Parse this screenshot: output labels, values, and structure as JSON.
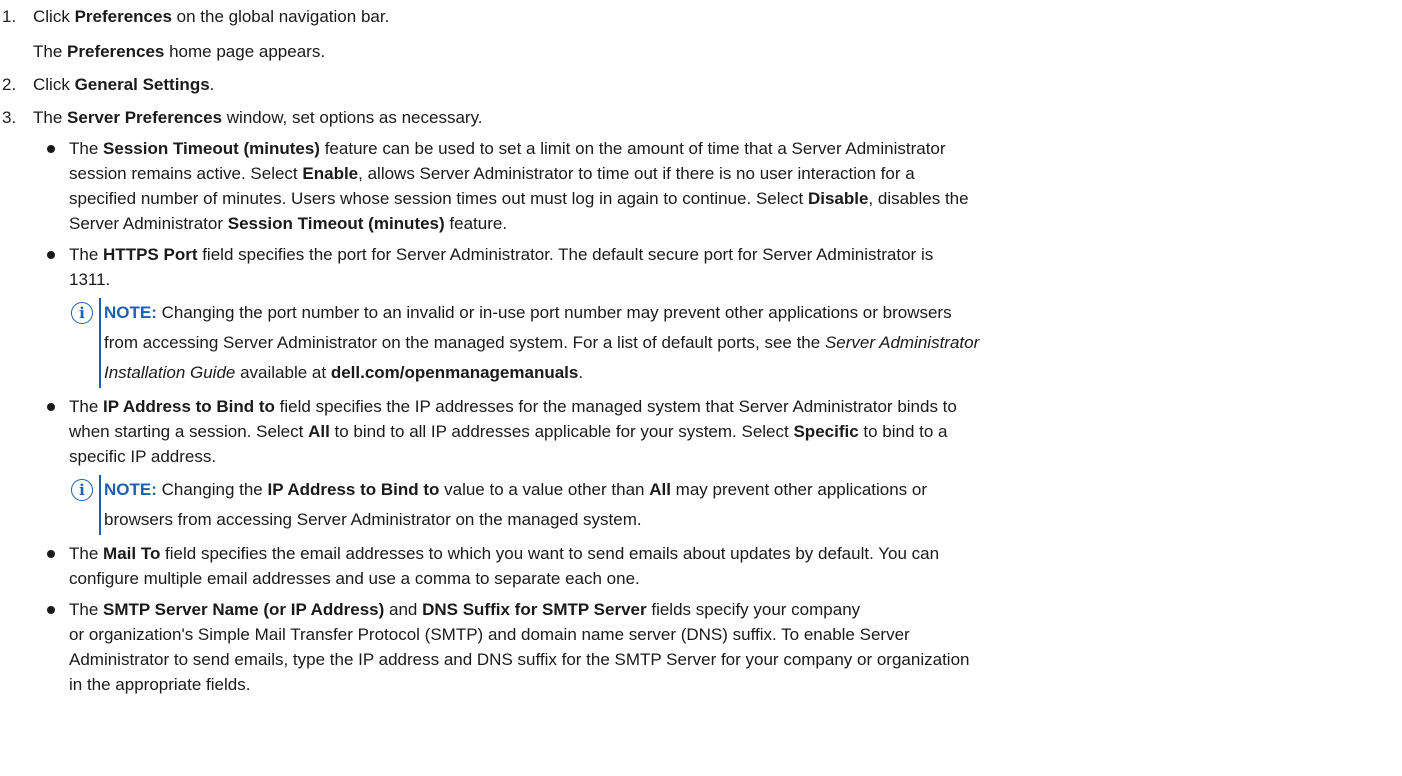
{
  "steps": [
    {
      "num": "1.",
      "pre": "Click ",
      "bold": "Preferences",
      "post": " on the global navigation bar.",
      "sub_pre": "The ",
      "sub_bold": "Preferences",
      "sub_post": " home page appears."
    },
    {
      "num": "2.",
      "pre": "Click ",
      "bold": "General Settings",
      "post": "."
    },
    {
      "num": "3.",
      "pre": "The ",
      "bold": "Server Preferences",
      "post": " window, set options as necessary."
    }
  ],
  "bullets": {
    "session": {
      "l1_pre": "The ",
      "l1_b1": "Session Timeout (minutes)",
      "l1_post": " feature can be used to set a limit on the amount of time that a Server Administrator",
      "l2_pre": "session remains active. Select ",
      "l2_b1": "Enable",
      "l2_post": ", allows Server Administrator to time out if there is no user interaction for a",
      "l3_pre": "specified number of minutes. Users whose session times out must log in again to continue. Select ",
      "l3_b1": "Disable",
      "l3_post": ", disables the",
      "l4_pre": "Server Administrator ",
      "l4_b1": "Session Timeout (minutes)",
      "l4_post": " feature."
    },
    "https": {
      "l1_pre": "The ",
      "l1_b1": "HTTPS Port",
      "l1_post": " field specifies the port for Server Administrator. The default secure port for Server Administrator is",
      "l2": "1311.",
      "note": {
        "label": "NOTE:",
        "l1": " Changing the port number to an invalid or in-use port number may prevent other applications or browsers",
        "l2_pre": "from accessing Server Administrator on the managed system. For a list of default ports, see the ",
        "l2_italic": "Server Administrator",
        "l3_italic": "Installation Guide",
        "l3_mid": " available at ",
        "l3_bold": "dell.com/openmanagemanuals",
        "l3_post": "."
      }
    },
    "ip": {
      "l1_pre": "The ",
      "l1_b1": "IP Address to Bind to",
      "l1_post": " field specifies the IP addresses for the managed system that Server Administrator binds to",
      "l2_pre": "when starting a session. Select ",
      "l2_b1": "All",
      "l2_mid": " to bind to all IP addresses applicable for your system. Select ",
      "l2_b2": "Specific",
      "l2_post": " to bind to a",
      "l3": "specific IP address.",
      "note": {
        "label": "NOTE:",
        "l1_pre": " Changing the ",
        "l1_b1": "IP Address to Bind to",
        "l1_mid": " value to a value other than ",
        "l1_b2": "All",
        "l1_post": " may prevent other applications or",
        "l2": "browsers from accessing Server Administrator on the managed system."
      }
    },
    "mail": {
      "l1_pre": "The ",
      "l1_b1": "Mail To",
      "l1_post": " field specifies the email addresses to which you want to send emails about updates by default. You can",
      "l2": "configure multiple email addresses and use a comma to separate each one."
    },
    "smtp": {
      "l1_pre": "The ",
      "l1_b1": "SMTP Server Name (or IP Address)",
      "l1_mid": " and ",
      "l1_b2": "DNS Suffix for SMTP Server",
      "l1_post": " fields specify your company",
      "l2": "or organization's Simple Mail Transfer Protocol (SMTP) and domain name server (DNS) suffix. To enable Server",
      "l3": "Administrator to send emails, type the IP address and DNS suffix for the SMTP Server for your company or organization",
      "l4": "in the appropriate fields."
    }
  },
  "icons": {
    "note": "info-icon",
    "note_glyph": "i"
  },
  "colors": {
    "accent": "#1d5fb0",
    "text": "#1a1a1a"
  }
}
